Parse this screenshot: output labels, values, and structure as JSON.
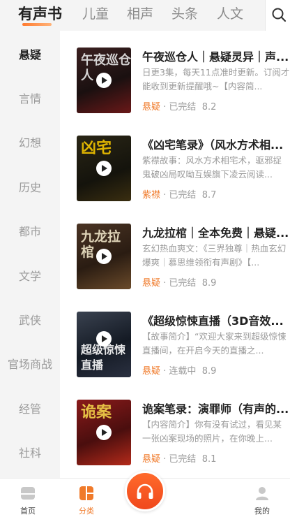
{
  "top_tabs": [
    "有声书",
    "儿童",
    "相声",
    "头条",
    "人文"
  ],
  "sidebar": [
    "悬疑",
    "言情",
    "幻想",
    "历史",
    "都市",
    "文学",
    "武侠",
    "官场商战",
    "经管",
    "社科"
  ],
  "books": [
    {
      "title": "午夜巡仓人｜悬疑灵异｜声...",
      "desc": "日更3集，每天11点准时更新。订阅才能收到更新提醒哦~【内容简...",
      "genre": "悬疑",
      "status": " · 已完结",
      "score": "8.2",
      "cover_text": "午夜巡仓人",
      "cover_color": "#2a1a1a"
    },
    {
      "title": "《凶宅笔录》（风水方术相...",
      "desc": "紫襟故事：风水方术相宅术，驱邪捉鬼破凶局叹呦互娱旗下凌云阅读...",
      "genre": "紫襟",
      "status": " · 已完结",
      "score": "8.7",
      "cover_text": "凶宅",
      "cover_color": "#1c1a12"
    },
    {
      "title": "九龙拉棺｜全本免费｜悬疑...",
      "desc": "玄幻热血爽文：《三界独尊｜热血玄幻爆爽｜慕思维领衔有声剧》【...",
      "genre": "悬疑",
      "status": " · 已完结",
      "score": "8.9",
      "cover_text": "九龙拉棺",
      "cover_color": "#3a2a1e"
    },
    {
      "title": "《超级惊悚直播（3D音效...",
      "desc": "【故事简介】“欢迎大家来到超级惊悚直播间，在开启今天的直播之...",
      "genre": "悬疑",
      "status": " · 连载中",
      "score": "8.9",
      "cover_text": "超级惊悚直播",
      "cover_color": "#1a2230"
    },
    {
      "title": "诡案笔录：演罪师（有声的...",
      "desc": "【内容简介】你有没有试过，看见某一张凶案现场的照片，在你晚上...",
      "genre": "悬疑",
      "status": " · 已完结",
      "score": "8.1",
      "cover_text": "诡案",
      "cover_color": "#5a1212"
    }
  ],
  "bottom_nav": {
    "home": "首页",
    "category": "分类",
    "mine": "我的"
  },
  "colors": {
    "accent": "#f07a2a",
    "play_button": "#f0481c"
  },
  "icons": {
    "search": "search-icon",
    "home": "home-icon",
    "category": "category-icon",
    "play": "headphones-icon",
    "mine": "user-icon"
  }
}
